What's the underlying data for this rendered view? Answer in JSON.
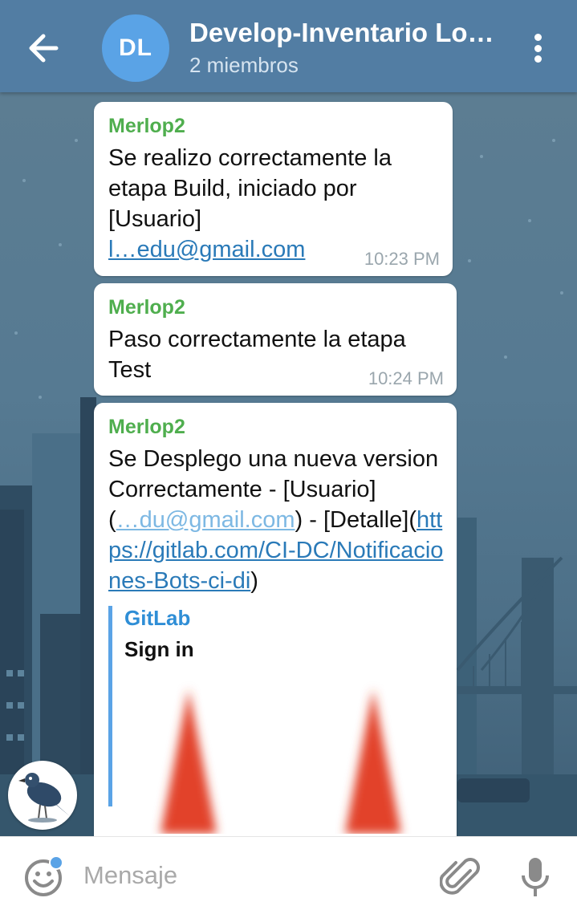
{
  "header": {
    "avatar_initials": "DL",
    "title": "Develop-Inventario Lo…",
    "subtitle": "2 miembros",
    "accent_color": "#527da3",
    "avatar_color": "#5aa3e6"
  },
  "messages": [
    {
      "sender": "Merlop2",
      "text": "Se realizo correctamente la etapa Build, iniciado por [Usuario]",
      "email": "l…edu@gmail.com",
      "time": "10:23 PM"
    },
    {
      "sender": "Merlop2",
      "text": "Paso correctamente la etapa Test",
      "time": "10:24 PM"
    },
    {
      "sender": "Merlop2",
      "text_1": "Se Desplego una nueva version Correctamente - [Usuario]",
      "paren_open": "(",
      "email": "…du@gmail.com",
      "paren_close": ") -",
      "text_2": "[Detalle](",
      "link": "https://gitlab.com/CI-DC/Notificaciones-Bots-ci-di",
      "text_3": ")",
      "preview": {
        "site": "GitLab",
        "title": "Sign in"
      }
    }
  ],
  "input": {
    "placeholder": "Mensaje"
  },
  "icons": {
    "back": "arrow-left-icon",
    "menu": "more-vertical-icon",
    "emoji": "emoji-icon",
    "attach": "paperclip-icon",
    "mic": "microphone-icon"
  },
  "colors": {
    "sender_name": "#4fae4e",
    "link": "#2a7ab8",
    "timestamp": "#9aa6ad",
    "chat_background": "#567a92"
  }
}
